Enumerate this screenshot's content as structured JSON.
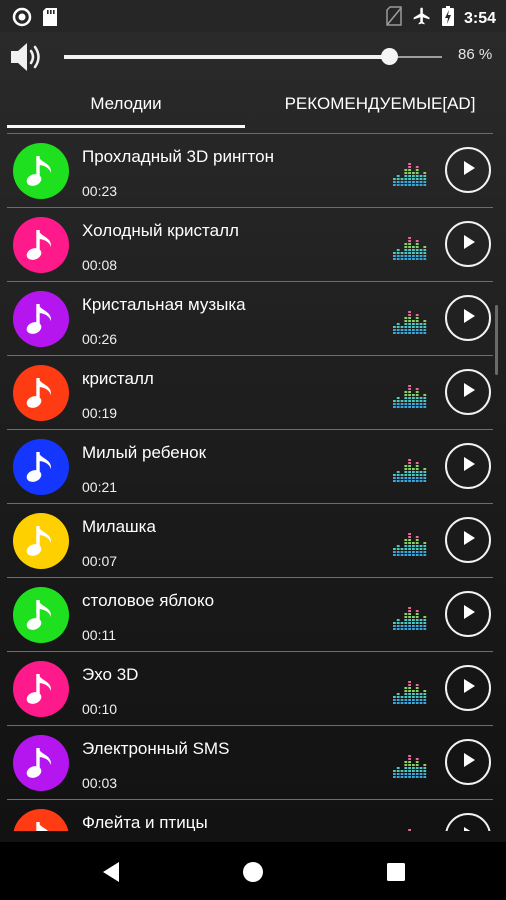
{
  "status_bar": {
    "time": "3:54"
  },
  "volume": {
    "level": 0.86,
    "label": "86 %"
  },
  "tabs": [
    {
      "label": "Мелодии",
      "active": true
    },
    {
      "label": "РЕКОМЕНДУЕМЫЕ[AD]",
      "active": false
    }
  ],
  "ringtones": [
    {
      "title": "Прохладный 3D рингтон",
      "duration": "00:23",
      "color": "#1ee01e"
    },
    {
      "title": "Холодный кристалл",
      "duration": "00:08",
      "color": "#ff1a8c"
    },
    {
      "title": "Кристальная музыка",
      "duration": "00:26",
      "color": "#b516f0"
    },
    {
      "title": "кристалл",
      "duration": "00:19",
      "color": "#ff3b14"
    },
    {
      "title": "Милый ребенок",
      "duration": "00:21",
      "color": "#1536ff"
    },
    {
      "title": "Милашка",
      "duration": "00:07",
      "color": "#ffd000"
    },
    {
      "title": "столовое яблоко",
      "duration": "00:11",
      "color": "#1ee01e"
    },
    {
      "title": "Эхо 3D",
      "duration": "00:10",
      "color": "#ff1a8c"
    },
    {
      "title": "Электронный SMS",
      "duration": "00:03",
      "color": "#b516f0"
    },
    {
      "title": "Флейта и птицы",
      "duration": "",
      "color": "#ff3b14"
    }
  ],
  "icons": {
    "status_left": [
      "notification-circle-icon",
      "sd-card-icon"
    ],
    "status_right": [
      "no-sim-icon",
      "airplane-icon",
      "battery-charging-icon"
    ],
    "volume": "speaker-volume-icon",
    "list_item": [
      "music-note-icon",
      "equalizer-icon",
      "play-icon"
    ],
    "nav": [
      "back-icon",
      "home-icon",
      "recents-icon"
    ]
  }
}
